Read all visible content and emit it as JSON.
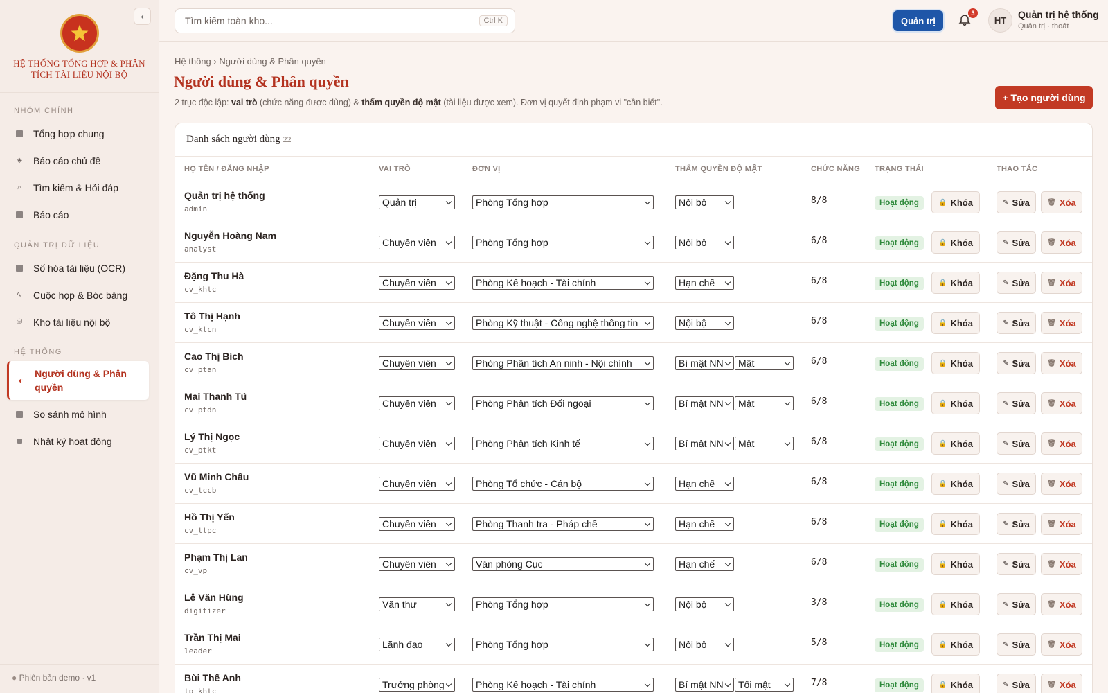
{
  "sidebar": {
    "org_name": "HỆ THỐNG TỔNG HỢP & PHÂN TÍCH TÀI LIỆU NỘI BỘ",
    "collapse_label": "‹",
    "groups": [
      {
        "label": "NHÓM CHÍNH"
      },
      {
        "label": "QUẢN TRỊ DỮ LIỆU"
      },
      {
        "label": "HỆ THỐNG"
      }
    ],
    "items": [
      {
        "label": "Tổng hợp chung",
        "icon": "square-icon"
      },
      {
        "label": "Báo cáo chủ đề",
        "icon": "diamond-icon"
      },
      {
        "label": "Tìm kiếm & Hỏi đáp",
        "icon": "search-icon"
      },
      {
        "label": "Báo cáo",
        "icon": "square-icon"
      },
      {
        "label": "Số hóa tài liệu (OCR)",
        "icon": "square-icon"
      },
      {
        "label": "Cuộc họp & Bóc băng",
        "icon": "wave-icon"
      },
      {
        "label": "Kho tài liệu nội bộ",
        "icon": "database-icon"
      },
      {
        "label": "Người dùng & Phân quyền",
        "icon": "half-circle-icon"
      },
      {
        "label": "So sánh mô hình",
        "icon": "square-icon"
      },
      {
        "label": "Nhật ký hoạt động",
        "icon": "small-square-icon"
      }
    ],
    "version": "Phiên bản demo · v1"
  },
  "topbar": {
    "search_placeholder": "Tìm kiếm toàn kho...",
    "search_shortcut": "Ctrl K",
    "role_button": "Quản trị",
    "notification_count": "3",
    "avatar_initials": "HT",
    "user_name": "Quản trị hệ thống",
    "user_sub": "Quản trị · thoát"
  },
  "page": {
    "breadcrumb": "Hệ thống › Người dùng & Phân quyền",
    "title": "Người dùng & Phân quyền",
    "desc_1": "2 trục độc lập: ",
    "desc_b1": "vai trò",
    "desc_2": " (chức năng được dùng) & ",
    "desc_b2": "thẩm quyền độ mật",
    "desc_3": " (tài liệu được xem). Đơn vị quyết định phạm vi \"cần biết\".",
    "create_button": "+ Tạo người dùng"
  },
  "table": {
    "title": "Danh sách người dùng",
    "count": "22",
    "columns": [
      "HỌ TÊN / ĐĂNG NHẬP",
      "VAI TRÒ",
      "ĐƠN VỊ",
      "THẨM QUYỀN ĐỘ MẬT",
      "CHỨC NĂNG",
      "TRẠNG THÁI",
      "THAO TÁC"
    ],
    "lock_label": "Khóa",
    "edit_label": "Sửa",
    "delete_label": "Xóa",
    "rows": [
      {
        "name": "Quản trị hệ thống",
        "login": "admin",
        "role": "Quản trị",
        "unit": "Phòng Tổng hợp",
        "clearance": "Nội bộ",
        "classification": "",
        "functions": "8/8",
        "status": "Hoạt động"
      },
      {
        "name": "Nguyễn Hoàng Nam",
        "login": "analyst",
        "role": "Chuyên viên",
        "unit": "Phòng Tổng hợp",
        "clearance": "Nội bộ",
        "classification": "",
        "functions": "6/8",
        "status": "Hoạt động"
      },
      {
        "name": "Đặng Thu Hà",
        "login": "cv_khtc",
        "role": "Chuyên viên",
        "unit": "Phòng Kế hoạch - Tài chính",
        "clearance": "Hạn chế",
        "classification": "",
        "functions": "6/8",
        "status": "Hoạt động"
      },
      {
        "name": "Tô Thị Hạnh",
        "login": "cv_ktcn",
        "role": "Chuyên viên",
        "unit": "Phòng Kỹ thuật - Công nghệ thông tin",
        "clearance": "Nội bộ",
        "classification": "",
        "functions": "6/8",
        "status": "Hoạt động"
      },
      {
        "name": "Cao Thị Bích",
        "login": "cv_ptan",
        "role": "Chuyên viên",
        "unit": "Phòng Phân tích An ninh - Nội chính",
        "clearance": "Bí mật NN",
        "classification": "Mật",
        "functions": "6/8",
        "status": "Hoạt động"
      },
      {
        "name": "Mai Thanh Tú",
        "login": "cv_ptdn",
        "role": "Chuyên viên",
        "unit": "Phòng Phân tích Đối ngoại",
        "clearance": "Bí mật NN",
        "classification": "Mật",
        "functions": "6/8",
        "status": "Hoạt động"
      },
      {
        "name": "Lý Thị Ngọc",
        "login": "cv_ptkt",
        "role": "Chuyên viên",
        "unit": "Phòng Phân tích Kinh tế",
        "clearance": "Bí mật NN",
        "classification": "Mật",
        "functions": "6/8",
        "status": "Hoạt động"
      },
      {
        "name": "Vũ Minh Châu",
        "login": "cv_tccb",
        "role": "Chuyên viên",
        "unit": "Phòng Tổ chức - Cán bộ",
        "clearance": "Hạn chế",
        "classification": "",
        "functions": "6/8",
        "status": "Hoạt động"
      },
      {
        "name": "Hồ Thị Yến",
        "login": "cv_ttpc",
        "role": "Chuyên viên",
        "unit": "Phòng Thanh tra - Pháp chế",
        "clearance": "Hạn chế",
        "classification": "",
        "functions": "6/8",
        "status": "Hoạt động"
      },
      {
        "name": "Phạm Thị Lan",
        "login": "cv_vp",
        "role": "Chuyên viên",
        "unit": "Văn phòng Cục",
        "clearance": "Hạn chế",
        "classification": "",
        "functions": "6/8",
        "status": "Hoạt động"
      },
      {
        "name": "Lê Văn Hùng",
        "login": "digitizer",
        "role": "Văn thư",
        "unit": "Phòng Tổng hợp",
        "clearance": "Nội bộ",
        "classification": "",
        "functions": "3/8",
        "status": "Hoạt động"
      },
      {
        "name": "Trần Thị Mai",
        "login": "leader",
        "role": "Lãnh đạo",
        "unit": "Phòng Tổng hợp",
        "clearance": "Nội bộ",
        "classification": "",
        "functions": "5/8",
        "status": "Hoạt động"
      },
      {
        "name": "Bùi Thế Anh",
        "login": "tp_khtc",
        "role": "Trưởng phòng",
        "unit": "Phòng Kế hoạch - Tài chính",
        "clearance": "Bí mật NN",
        "classification": "Tối mật",
        "functions": "7/8",
        "status": "Hoạt động"
      }
    ]
  }
}
